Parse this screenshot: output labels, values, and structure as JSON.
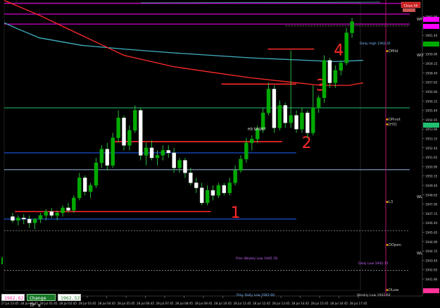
{
  "colors": {
    "background": "#000000",
    "candle_up": "#00aa00",
    "candle_down": "#ffffff",
    "wick": "#2ecc40",
    "magenta": "#ff00ff",
    "cyan_line": "#40b0c0",
    "red": "#ff2a2a",
    "green_level": "#20c070",
    "blue_level": "#2060ff",
    "grey_dotted": "#888888",
    "pink_label": "#ff55aa"
  },
  "top_right_label": "Close All",
  "bottom_boxes": {
    "left_value": "1962.62",
    "change_tp_label": "Change TP",
    "change_tp_arrows": "⇅",
    "right_value": "1962.52"
  },
  "chart_data": {
    "type": "candlestick",
    "ylim": [
      1941,
      1964
    ],
    "y_ticks": [
      "1962.90",
      "1962.15",
      "1961.40",
      "1960.65",
      "1959.90",
      "1959.15",
      "1958.40",
      "1957.65",
      "1956.90",
      "1956.15",
      "1955.40",
      "1954.65",
      "1953.90",
      "1953.15",
      "1952.40",
      "1951.65",
      "1950.90",
      "1950.15",
      "1949.40",
      "1948.65",
      "1947.90",
      "1947.15",
      "1946.40",
      "1945.65",
      "1944.90",
      "1944.15",
      "1943.40",
      "1942.65",
      "1941.90"
    ],
    "x_ticks": [
      "27 Jul 23:45",
      "28 Jul 00:45",
      "28 Jul 01:45",
      "28 Jul 02:45",
      "28 Jul 03:45",
      "28 Jul 04:45",
      "28 Jul 05:45",
      "28 Jul 06:45",
      "28 Jul 07:45",
      "28 Jul 08:45",
      "28 Jul 09:45",
      "28 Jul 10:45",
      "28 Jul 11:45",
      "28 Jul 12:45",
      "28 Jul 13:45",
      "28 Jul 14:45",
      "28 Jul 15:45",
      "28 Jul 16:45",
      "28 Jul 17:45"
    ],
    "candles": [
      [
        1946.9,
        1947.2,
        1946.4,
        1946.6
      ],
      [
        1946.6,
        1947.0,
        1946.2,
        1946.8
      ],
      [
        1946.8,
        1947.1,
        1946.3,
        1946.7
      ],
      [
        1946.7,
        1947.0,
        1946.0,
        1946.4
      ],
      [
        1946.4,
        1946.8,
        1945.9,
        1946.7
      ],
      [
        1946.7,
        1947.2,
        1946.4,
        1947.0
      ],
      [
        1947.0,
        1947.5,
        1946.6,
        1947.3
      ],
      [
        1947.3,
        1947.6,
        1946.8,
        1947.0
      ],
      [
        1947.0,
        1947.4,
        1946.6,
        1947.2
      ],
      [
        1947.2,
        1947.8,
        1946.9,
        1947.6
      ],
      [
        1947.6,
        1948.0,
        1947.2,
        1947.4
      ],
      [
        1947.4,
        1948.6,
        1947.2,
        1948.4
      ],
      [
        1948.4,
        1950.4,
        1948.2,
        1950.0
      ],
      [
        1950.0,
        1950.2,
        1948.6,
        1948.9
      ],
      [
        1948.9,
        1949.6,
        1948.4,
        1949.4
      ],
      [
        1949.4,
        1951.6,
        1949.2,
        1951.2
      ],
      [
        1951.2,
        1952.6,
        1950.8,
        1952.3
      ],
      [
        1952.3,
        1952.8,
        1950.6,
        1951.0
      ],
      [
        1951.0,
        1953.6,
        1950.8,
        1953.2
      ],
      [
        1953.2,
        1955.4,
        1952.8,
        1954.8
      ],
      [
        1954.8,
        1955.0,
        1952.2,
        1952.6
      ],
      [
        1952.6,
        1954.2,
        1952.2,
        1953.8
      ],
      [
        1953.8,
        1955.8,
        1953.6,
        1955.4
      ],
      [
        1955.4,
        1955.6,
        1951.4,
        1951.8
      ],
      [
        1951.8,
        1952.8,
        1951.0,
        1952.4
      ],
      [
        1952.4,
        1953.0,
        1951.4,
        1951.6
      ],
      [
        1951.6,
        1952.2,
        1951.0,
        1951.8
      ],
      [
        1951.8,
        1952.6,
        1951.4,
        1952.2
      ],
      [
        1952.2,
        1952.6,
        1951.6,
        1952.0
      ],
      [
        1952.0,
        1952.4,
        1950.4,
        1950.8
      ],
      [
        1950.8,
        1951.6,
        1950.4,
        1951.4
      ],
      [
        1951.4,
        1951.6,
        1950.0,
        1950.4
      ],
      [
        1950.4,
        1950.8,
        1949.4,
        1949.6
      ],
      [
        1949.6,
        1950.0,
        1948.8,
        1949.2
      ],
      [
        1949.2,
        1949.6,
        1947.8,
        1948.0
      ],
      [
        1948.0,
        1949.4,
        1947.8,
        1949.0
      ],
      [
        1949.0,
        1949.4,
        1948.2,
        1948.6
      ],
      [
        1948.6,
        1949.6,
        1948.4,
        1949.4
      ],
      [
        1949.4,
        1949.6,
        1948.6,
        1948.8
      ],
      [
        1948.8,
        1950.0,
        1948.6,
        1949.6
      ],
      [
        1949.6,
        1951.0,
        1949.4,
        1950.6
      ],
      [
        1950.6,
        1951.8,
        1950.4,
        1951.5
      ],
      [
        1951.5,
        1953.2,
        1951.2,
        1952.8
      ],
      [
        1952.8,
        1953.4,
        1952.2,
        1953.1
      ],
      [
        1953.1,
        1954.2,
        1952.8,
        1953.9
      ],
      [
        1953.9,
        1955.6,
        1953.6,
        1955.2
      ],
      [
        1955.2,
        1957.6,
        1955.0,
        1957.1
      ],
      [
        1957.1,
        1957.4,
        1953.6,
        1954.0
      ],
      [
        1954.0,
        1956.2,
        1953.8,
        1955.8
      ],
      [
        1955.8,
        1956.0,
        1954.0,
        1954.4
      ],
      [
        1954.4,
        1960.2,
        1954.0,
        1955.0
      ],
      [
        1955.0,
        1955.4,
        1953.6,
        1953.9
      ],
      [
        1953.9,
        1955.6,
        1953.6,
        1955.2
      ],
      [
        1955.2,
        1955.4,
        1953.2,
        1953.6
      ],
      [
        1953.6,
        1957.4,
        1953.4,
        1955.6
      ],
      [
        1955.6,
        1956.6,
        1955.2,
        1956.4
      ],
      [
        1956.4,
        1959.8,
        1956.0,
        1959.4
      ],
      [
        1959.4,
        1959.6,
        1957.2,
        1957.6
      ],
      [
        1957.6,
        1959.0,
        1957.2,
        1958.6
      ],
      [
        1958.6,
        1959.4,
        1958.2,
        1959.2
      ],
      [
        1959.2,
        1962.0,
        1959.0,
        1961.6
      ],
      [
        1961.6,
        1962.8,
        1961.2,
        1962.5
      ]
    ],
    "lines": [
      {
        "name": "cyan MA",
        "points": [
          [
            0,
            1962.4
          ],
          [
            20,
            1961.9
          ],
          [
            50,
            1961.2
          ],
          [
            110,
            1960.6
          ],
          [
            170,
            1960.3
          ],
          [
            240,
            1960.0
          ],
          [
            350,
            1959.6
          ],
          [
            430,
            1959.4
          ],
          [
            470,
            1959.3
          ],
          [
            510,
            1959.4
          ]
        ]
      },
      {
        "name": "red MA",
        "points": [
          [
            0,
            1964.2
          ],
          [
            50,
            1963.0
          ],
          [
            110,
            1961.4
          ],
          [
            170,
            1959.8
          ],
          [
            240,
            1958.9
          ],
          [
            300,
            1958.4
          ],
          [
            350,
            1958.0
          ],
          [
            400,
            1957.7
          ],
          [
            450,
            1957.4
          ],
          [
            490,
            1957.4
          ],
          [
            510,
            1957.6
          ]
        ]
      }
    ],
    "levels": [
      {
        "name": "top magenta",
        "y": 1963.95,
        "x0": 0,
        "x1": 1,
        "color": "magenta"
      },
      {
        "name": "magenta upper",
        "y": 1963.1,
        "x0": 0,
        "x1": 1,
        "color": "magenta"
      },
      {
        "name": "magenta lower",
        "y": 1962.3,
        "x0": 0,
        "x1": 1,
        "color": "magenta"
      },
      {
        "name": "daily high",
        "y": 1962.15,
        "x0": 0.79,
        "x1": 1,
        "color": "grey"
      },
      {
        "name": "DPivot",
        "y": 1955.6,
        "x0": 0,
        "x1": 1,
        "color": "green"
      },
      {
        "name": "blue upper",
        "y": 1952.0,
        "x0": 0,
        "x1": 0.82,
        "color": "blue"
      },
      {
        "name": "L3",
        "y": 1950.65,
        "x0": 0,
        "x1": 1,
        "color": "lightblue"
      },
      {
        "name": "blue lower",
        "y": 1946.7,
        "x0": 0,
        "x1": 0.82,
        "color": "blue"
      },
      {
        "name": "prev weekly low",
        "y": 1945.78,
        "x0": 0,
        "x1": 1,
        "color": "grey"
      },
      {
        "name": "bottom dotted",
        "y": 1942.6,
        "x0": 0,
        "x1": 1,
        "color": "grey"
      }
    ],
    "red_levels": [
      {
        "y": 1947.3,
        "x0": 0.03,
        "x1": 0.58,
        "num": "1"
      },
      {
        "y": 1952.9,
        "x0": 0.31,
        "x1": 0.78,
        "num": "2"
      },
      {
        "y": 1957.5,
        "x0": 0.61,
        "x1": 0.82,
        "num": "3"
      },
      {
        "y": 1960.3,
        "x0": 0.74,
        "x1": 0.87,
        "num": "4"
      }
    ],
    "labels": {
      "daily_high": "Daily High 1962.41",
      "h3_short": "H3 SHORT",
      "prev_weekly_low": "Prev Weekly Low 1945.78",
      "daily_low": "Daily Low 1945.15",
      "weekly_low_prefix": "Prev Daily Low 1942.60",
      "weekly_low": "Weekly Low 1942.60",
      "right_tags": [
        "DMid",
        "DPivot",
        "[H3]",
        "L3",
        "DOpen",
        "DLow"
      ],
      "far_right_tags": [
        "WP",
        "WO",
        "WL",
        "WL"
      ]
    }
  }
}
